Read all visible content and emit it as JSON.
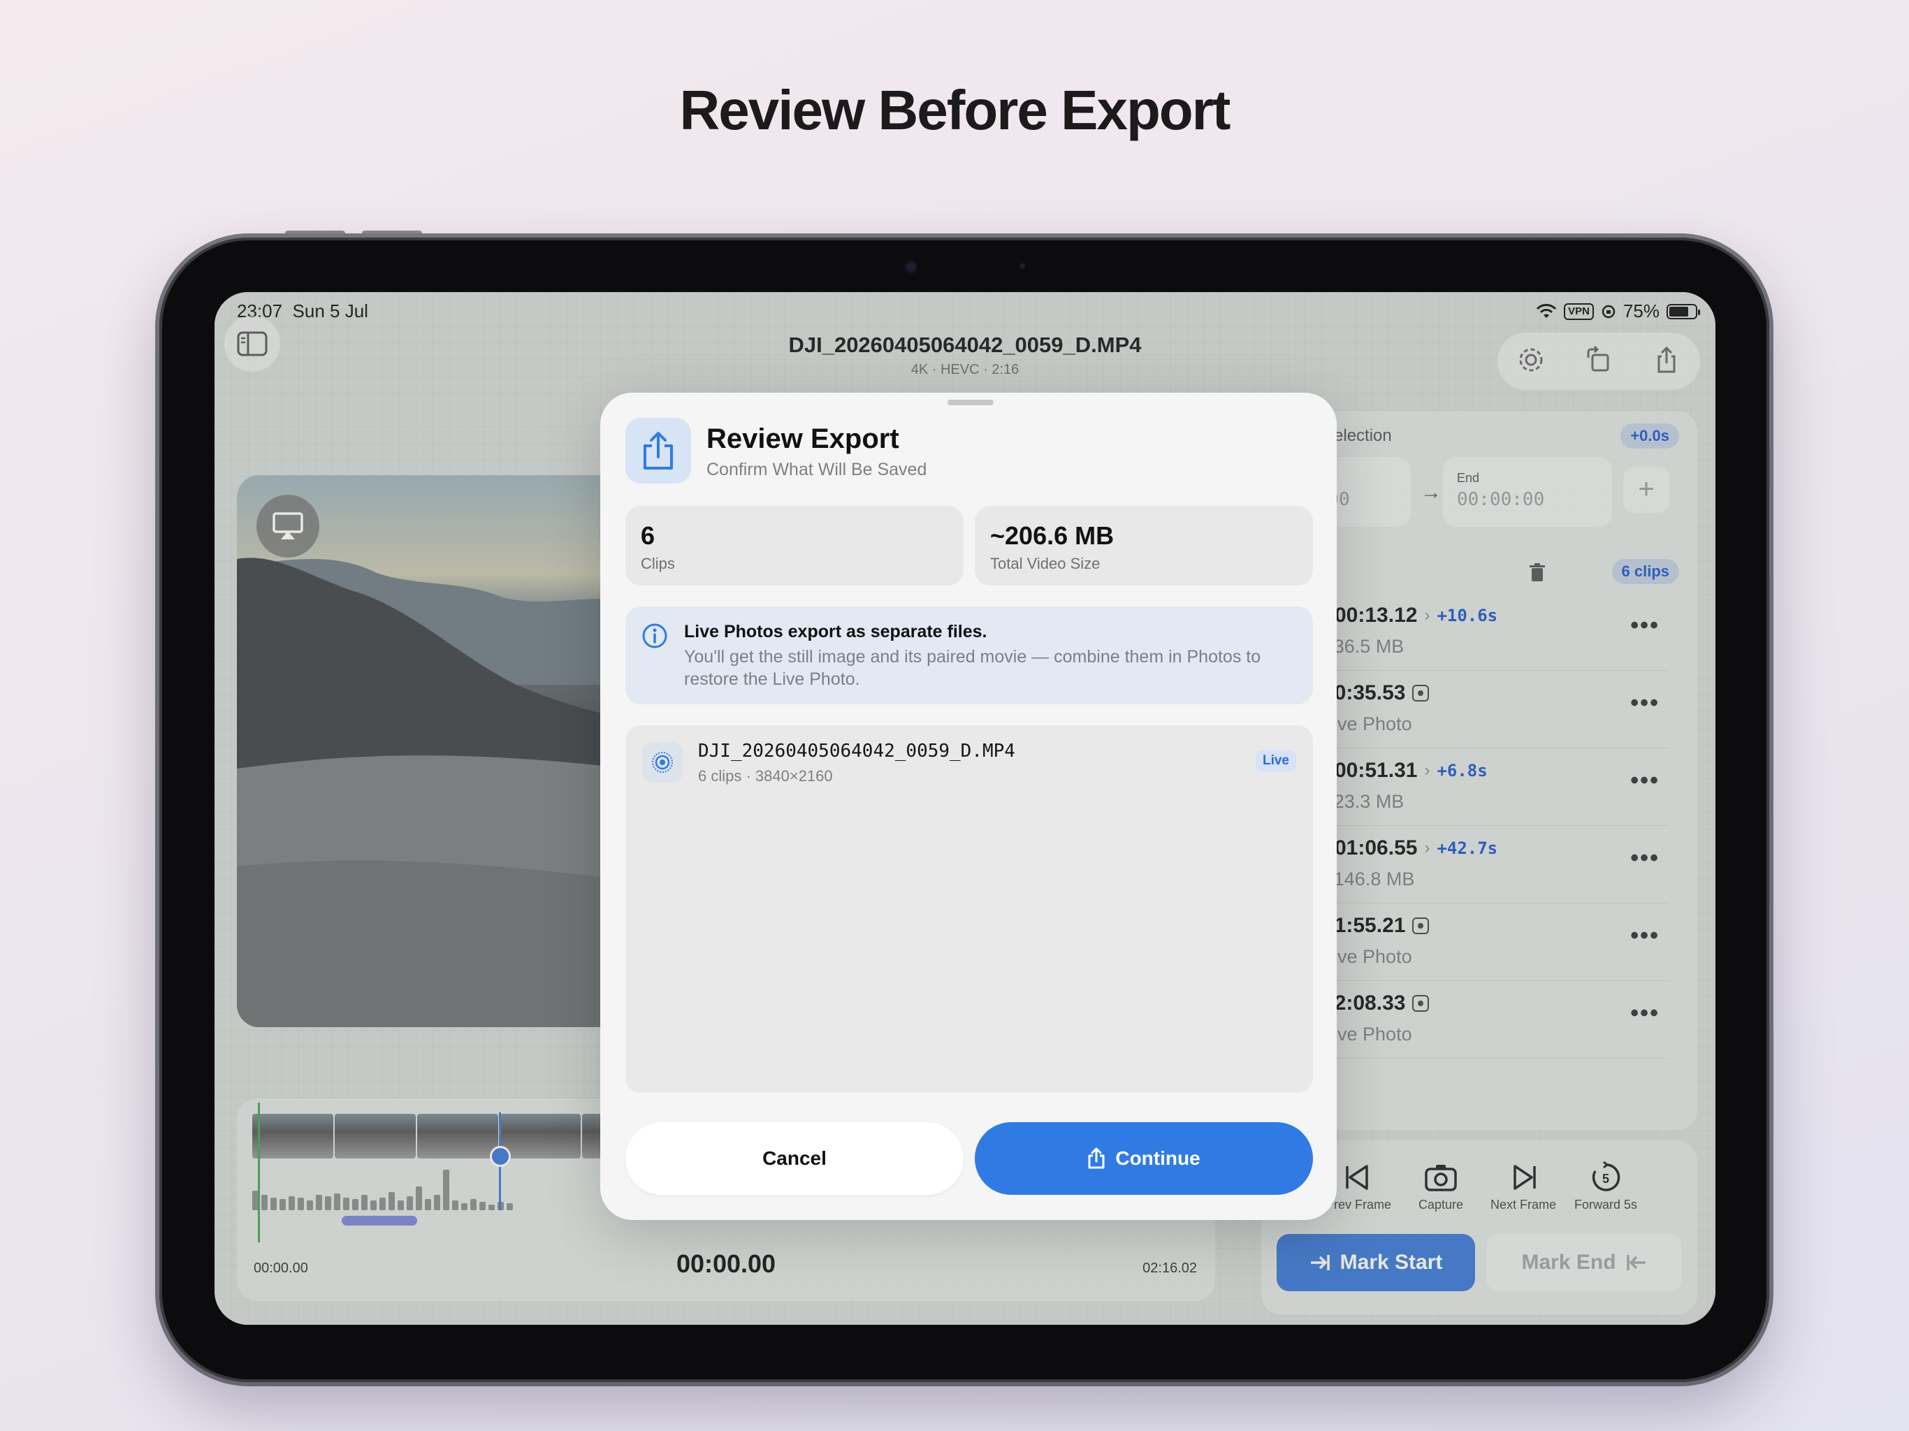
{
  "headline": "Review Before Export",
  "status_bar": {
    "time": "23:07",
    "date": "Sun 5 Jul",
    "vpn": "VPN",
    "battery": "75%"
  },
  "header": {
    "file_name": "DJI_20260405064042_0059_D.MP4",
    "file_info": "4K · HEVC · 2:16"
  },
  "selection": {
    "label": "Selection",
    "delta": "+0.0s",
    "start_value": "0:00",
    "end_label": "End",
    "end_value": "00:00:00"
  },
  "clips_panel": {
    "count_badge": "6 clips",
    "clips": [
      {
        "timecode": "00:13.12",
        "duration": "+10.6s",
        "detail": "~36.5 MB",
        "color": "#3a5fd0",
        "kind": "video"
      },
      {
        "timecode": "00:35.53",
        "duration": "",
        "detail": "Live Photo",
        "color": "",
        "kind": "live"
      },
      {
        "timecode": "00:51.31",
        "duration": "+6.8s",
        "detail": "~23.3 MB",
        "color": "#d36a1c",
        "kind": "video"
      },
      {
        "timecode": "01:06.55",
        "duration": "+42.7s",
        "detail": "~146.8 MB",
        "color": "#c8382f",
        "kind": "video"
      },
      {
        "timecode": "01:55.21",
        "duration": "",
        "detail": "Live Photo",
        "color": "",
        "kind": "live"
      },
      {
        "timecode": "02:08.33",
        "duration": "",
        "detail": "Live Photo",
        "color": "",
        "kind": "live"
      }
    ]
  },
  "controls": {
    "partial_label": "s",
    "prev_frame": "Prev Frame",
    "capture": "Capture",
    "next_frame": "Next Frame",
    "forward": "Forward 5s",
    "forward_icon_number": "5",
    "mark_start": "Mark Start",
    "mark_end": "Mark End"
  },
  "timeline": {
    "start_time": "00:00.00",
    "current_time": "00:00.00",
    "end_time": "02:16.02"
  },
  "modal": {
    "title": "Review Export",
    "subtitle": "Confirm What Will Be Saved",
    "stats": [
      {
        "value": "6",
        "label": "Clips"
      },
      {
        "value": "~206.6 MB",
        "label": "Total Video Size"
      }
    ],
    "info_title": "Live Photos export as separate files.",
    "info_body": "You'll get the still image and its paired movie — combine them in Photos to restore the Live Photo.",
    "file": {
      "name": "DJI_20260405064042_0059_D.MP4",
      "meta": "6 clips · 3840×2160",
      "badge": "Live"
    },
    "cancel_label": "Cancel",
    "continue_label": "Continue"
  },
  "colors": {
    "accent": "#2f7be3",
    "mark_start": "#3b78d6",
    "link_blue": "#1f57c9"
  }
}
